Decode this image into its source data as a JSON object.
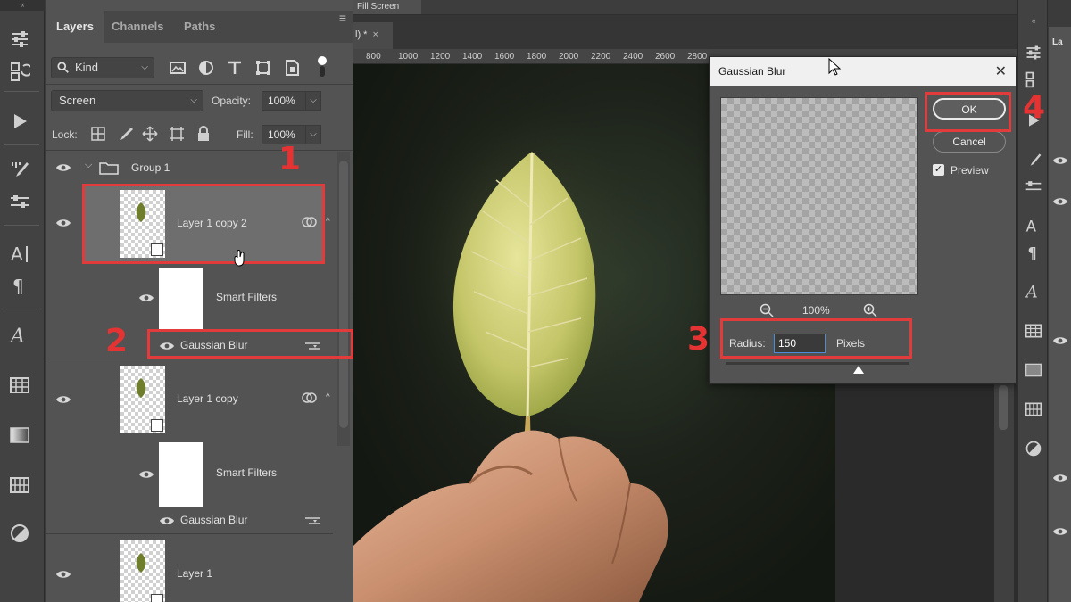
{
  "topbar": {
    "fill_screen_label": "Fill Screen"
  },
  "document": {
    "tab_label": "l) *",
    "close": "×"
  },
  "ruler_ticks": [
    "800",
    "1000",
    "1200",
    "1400",
    "1600",
    "1800",
    "2000",
    "2200",
    "2400",
    "2600",
    "2800"
  ],
  "layers_panel": {
    "tabs": [
      "Layers",
      "Channels",
      "Paths"
    ],
    "active_tab": "Layers",
    "filter_kind": "Kind",
    "blend_mode": "Screen",
    "opacity_label": "Opacity:",
    "opacity_value": "100%",
    "lock_label": "Lock:",
    "fill_label": "Fill:",
    "fill_value": "100%",
    "group_name": "Group 1",
    "layers": [
      {
        "name": "Layer 1 copy 2",
        "smart_filters_label": "Smart Filters",
        "filter_name": "Gaussian Blur",
        "selected": true
      },
      {
        "name": "Layer 1 copy",
        "smart_filters_label": "Smart Filters",
        "filter_name": "Gaussian Blur",
        "selected": false
      },
      {
        "name": "Layer 1",
        "selected": false
      }
    ]
  },
  "dialog": {
    "title": "Gaussian Blur",
    "close": "✕",
    "zoom_value": "100%",
    "radius_label": "Radius:",
    "radius_value": "150",
    "radius_unit": "Pixels",
    "ok_label": "OK",
    "cancel_label": "Cancel",
    "preview_label": "Preview",
    "preview_checked": true
  },
  "annotations": [
    "1",
    "2",
    "3",
    "4"
  ],
  "right_panel": {
    "tab_label": "La"
  },
  "colors": {
    "annotation_red": "#e23b3b",
    "panel_bg": "#535353",
    "selected_layer_bg": "#6e6e6e"
  }
}
